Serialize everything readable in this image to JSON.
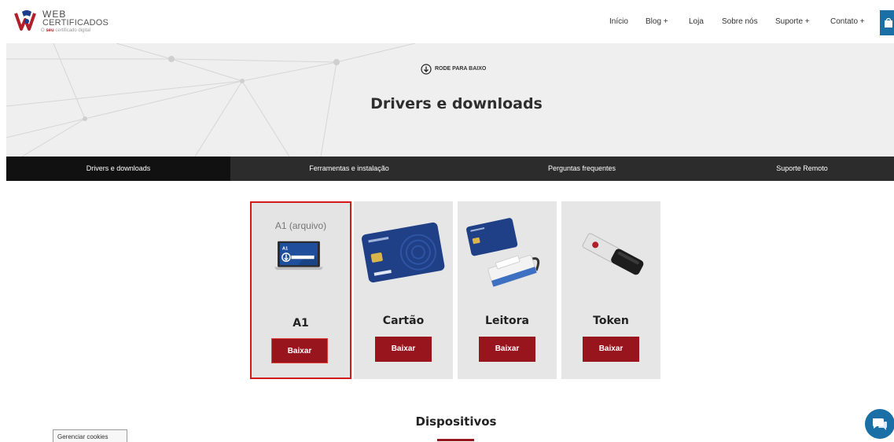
{
  "header": {
    "logo": {
      "web": "WEB",
      "certificados": "CERTIFICADOS",
      "tagline_prefix": "O",
      "tagline_bold": "seu",
      "tagline_rest": "certificado digital"
    },
    "nav": [
      {
        "label": "Início"
      },
      {
        "label": "Blog  +"
      },
      {
        "label": "Loja"
      },
      {
        "label": "Sobre nós"
      },
      {
        "label": "Suporte  +"
      },
      {
        "label": "Contato  +"
      }
    ],
    "cart_icon": "shopping-bag-icon"
  },
  "hero": {
    "scroll_cue": "RODE PARA BAIXO",
    "title": "Drivers e downloads"
  },
  "tabs": [
    {
      "label": "Drivers e downloads",
      "active": true
    },
    {
      "label": "Ferramentas e instalação",
      "active": false
    },
    {
      "label": "Perguntas frequentes",
      "active": false
    },
    {
      "label": "Suporte Remoto",
      "active": false
    }
  ],
  "cards": [
    {
      "image_caption": "A1 (arquivo)",
      "image_badge": "A1",
      "title": "A1",
      "button": "Baixar",
      "selected": true
    },
    {
      "title": "Cartão",
      "button": "Baixar",
      "selected": false
    },
    {
      "title": "Leitora",
      "button": "Baixar",
      "selected": false
    },
    {
      "title": "Token",
      "button": "Baixar",
      "selected": false
    }
  ],
  "section": {
    "title": "Dispositivos"
  },
  "cookies": {
    "label": "Gerenciar cookies"
  },
  "colors": {
    "brand_red": "#99151d",
    "accent_blue": "#1a6fa6",
    "tab_bar": "#2c2c2c"
  }
}
